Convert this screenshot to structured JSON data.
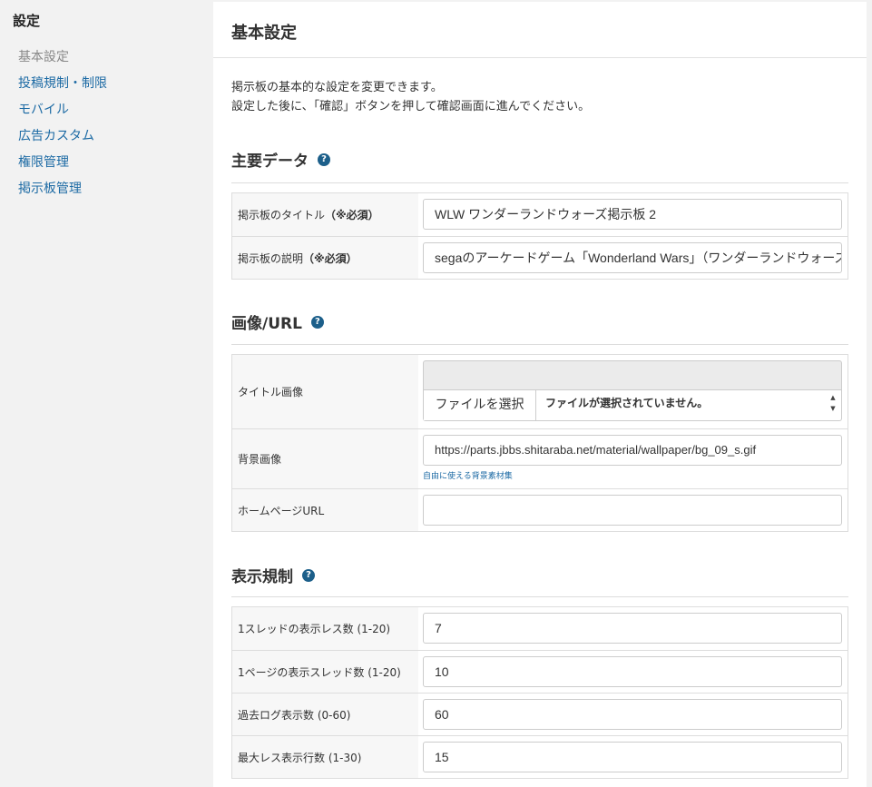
{
  "sidebar": {
    "title": "設定",
    "items": [
      {
        "label": "基本設定"
      },
      {
        "label": "投稿規制・制限"
      },
      {
        "label": "モバイル"
      },
      {
        "label": "広告カスタム"
      },
      {
        "label": "権限管理"
      },
      {
        "label": "掲示板管理"
      }
    ]
  },
  "main": {
    "title": "基本設定",
    "intro_line1": "掲示板の基本的な設定を変更できます。",
    "intro_line2": "設定した後に、「確認」ボタンを押して確認画面に進んでください。"
  },
  "help_icon_glyph": "?",
  "sections": {
    "main_data": {
      "heading": "主要データ",
      "board_title_label": "掲示板のタイトル",
      "board_title_required": "（※必須）",
      "board_title_value": "WLW ワンダーランドウォーズ掲示板 2",
      "board_desc_label": "掲示板の説明",
      "board_desc_required": "（※必須）",
      "board_desc_value": "segaのアーケードゲーム「Wonderland Wars」（ワンダーランドウォーズ）"
    },
    "image_url": {
      "heading": "画像/URL",
      "title_image_label": "タイトル画像",
      "file_button_label": "ファイルを選択",
      "file_status": "ファイルが選択されていません。",
      "bg_image_label": "背景画像",
      "bg_image_value": "https://parts.jbbs.shitaraba.net/material/wallpaper/bg_09_s.gif",
      "bg_helper_link": "自由に使える背景素材集",
      "homepage_label": "ホームページURL",
      "homepage_value": ""
    },
    "display": {
      "heading": "表示規制",
      "rows": [
        {
          "label": "1スレッドの表示レス数 (1-20)",
          "value": "7"
        },
        {
          "label": "1ページの表示スレッド数 (1-20)",
          "value": "10"
        },
        {
          "label": "過去ログ表示数 (0-60)",
          "value": "60"
        },
        {
          "label": "最大レス表示行数 (1-30)",
          "value": "15"
        }
      ]
    }
  }
}
